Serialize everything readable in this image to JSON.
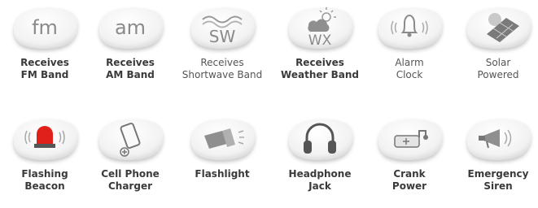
{
  "features": [
    {
      "id": "fm",
      "icon": "fm-text-icon",
      "icon_text": "fm",
      "label": "Receives\nFM Band",
      "bold": true
    },
    {
      "id": "am",
      "icon": "am-text-icon",
      "icon_text": "am",
      "label": "Receives\nAM Band",
      "bold": true
    },
    {
      "id": "sw",
      "icon": "shortwave-icon",
      "icon_text": "SW",
      "label": "Receives\nShortwave Band",
      "bold": false
    },
    {
      "id": "wx",
      "icon": "weather-icon",
      "icon_text": "WX",
      "label": "Receives\nWeather Band",
      "bold": true
    },
    {
      "id": "alarm",
      "icon": "alarm-bell-icon",
      "label": "Alarm\nClock",
      "bold": false
    },
    {
      "id": "solar",
      "icon": "solar-panel-icon",
      "label": "Solar\nPowered",
      "bold": false
    },
    {
      "id": "beacon",
      "icon": "flashing-beacon-icon",
      "label": "Flashing\nBeacon",
      "bold": true,
      "accent": "#e0201b"
    },
    {
      "id": "charger",
      "icon": "cell-phone-icon",
      "label": "Cell Phone\nCharger",
      "bold": true
    },
    {
      "id": "flashlight",
      "icon": "flashlight-icon",
      "label": "Flashlight",
      "bold": true
    },
    {
      "id": "headphone",
      "icon": "headphones-icon",
      "label": "Headphone\nJack",
      "bold": true
    },
    {
      "id": "crank",
      "icon": "crank-battery-icon",
      "label": "Crank\nPower",
      "bold": true
    },
    {
      "id": "siren",
      "icon": "megaphone-icon",
      "label": "Emergency\nSiren",
      "bold": true
    }
  ]
}
